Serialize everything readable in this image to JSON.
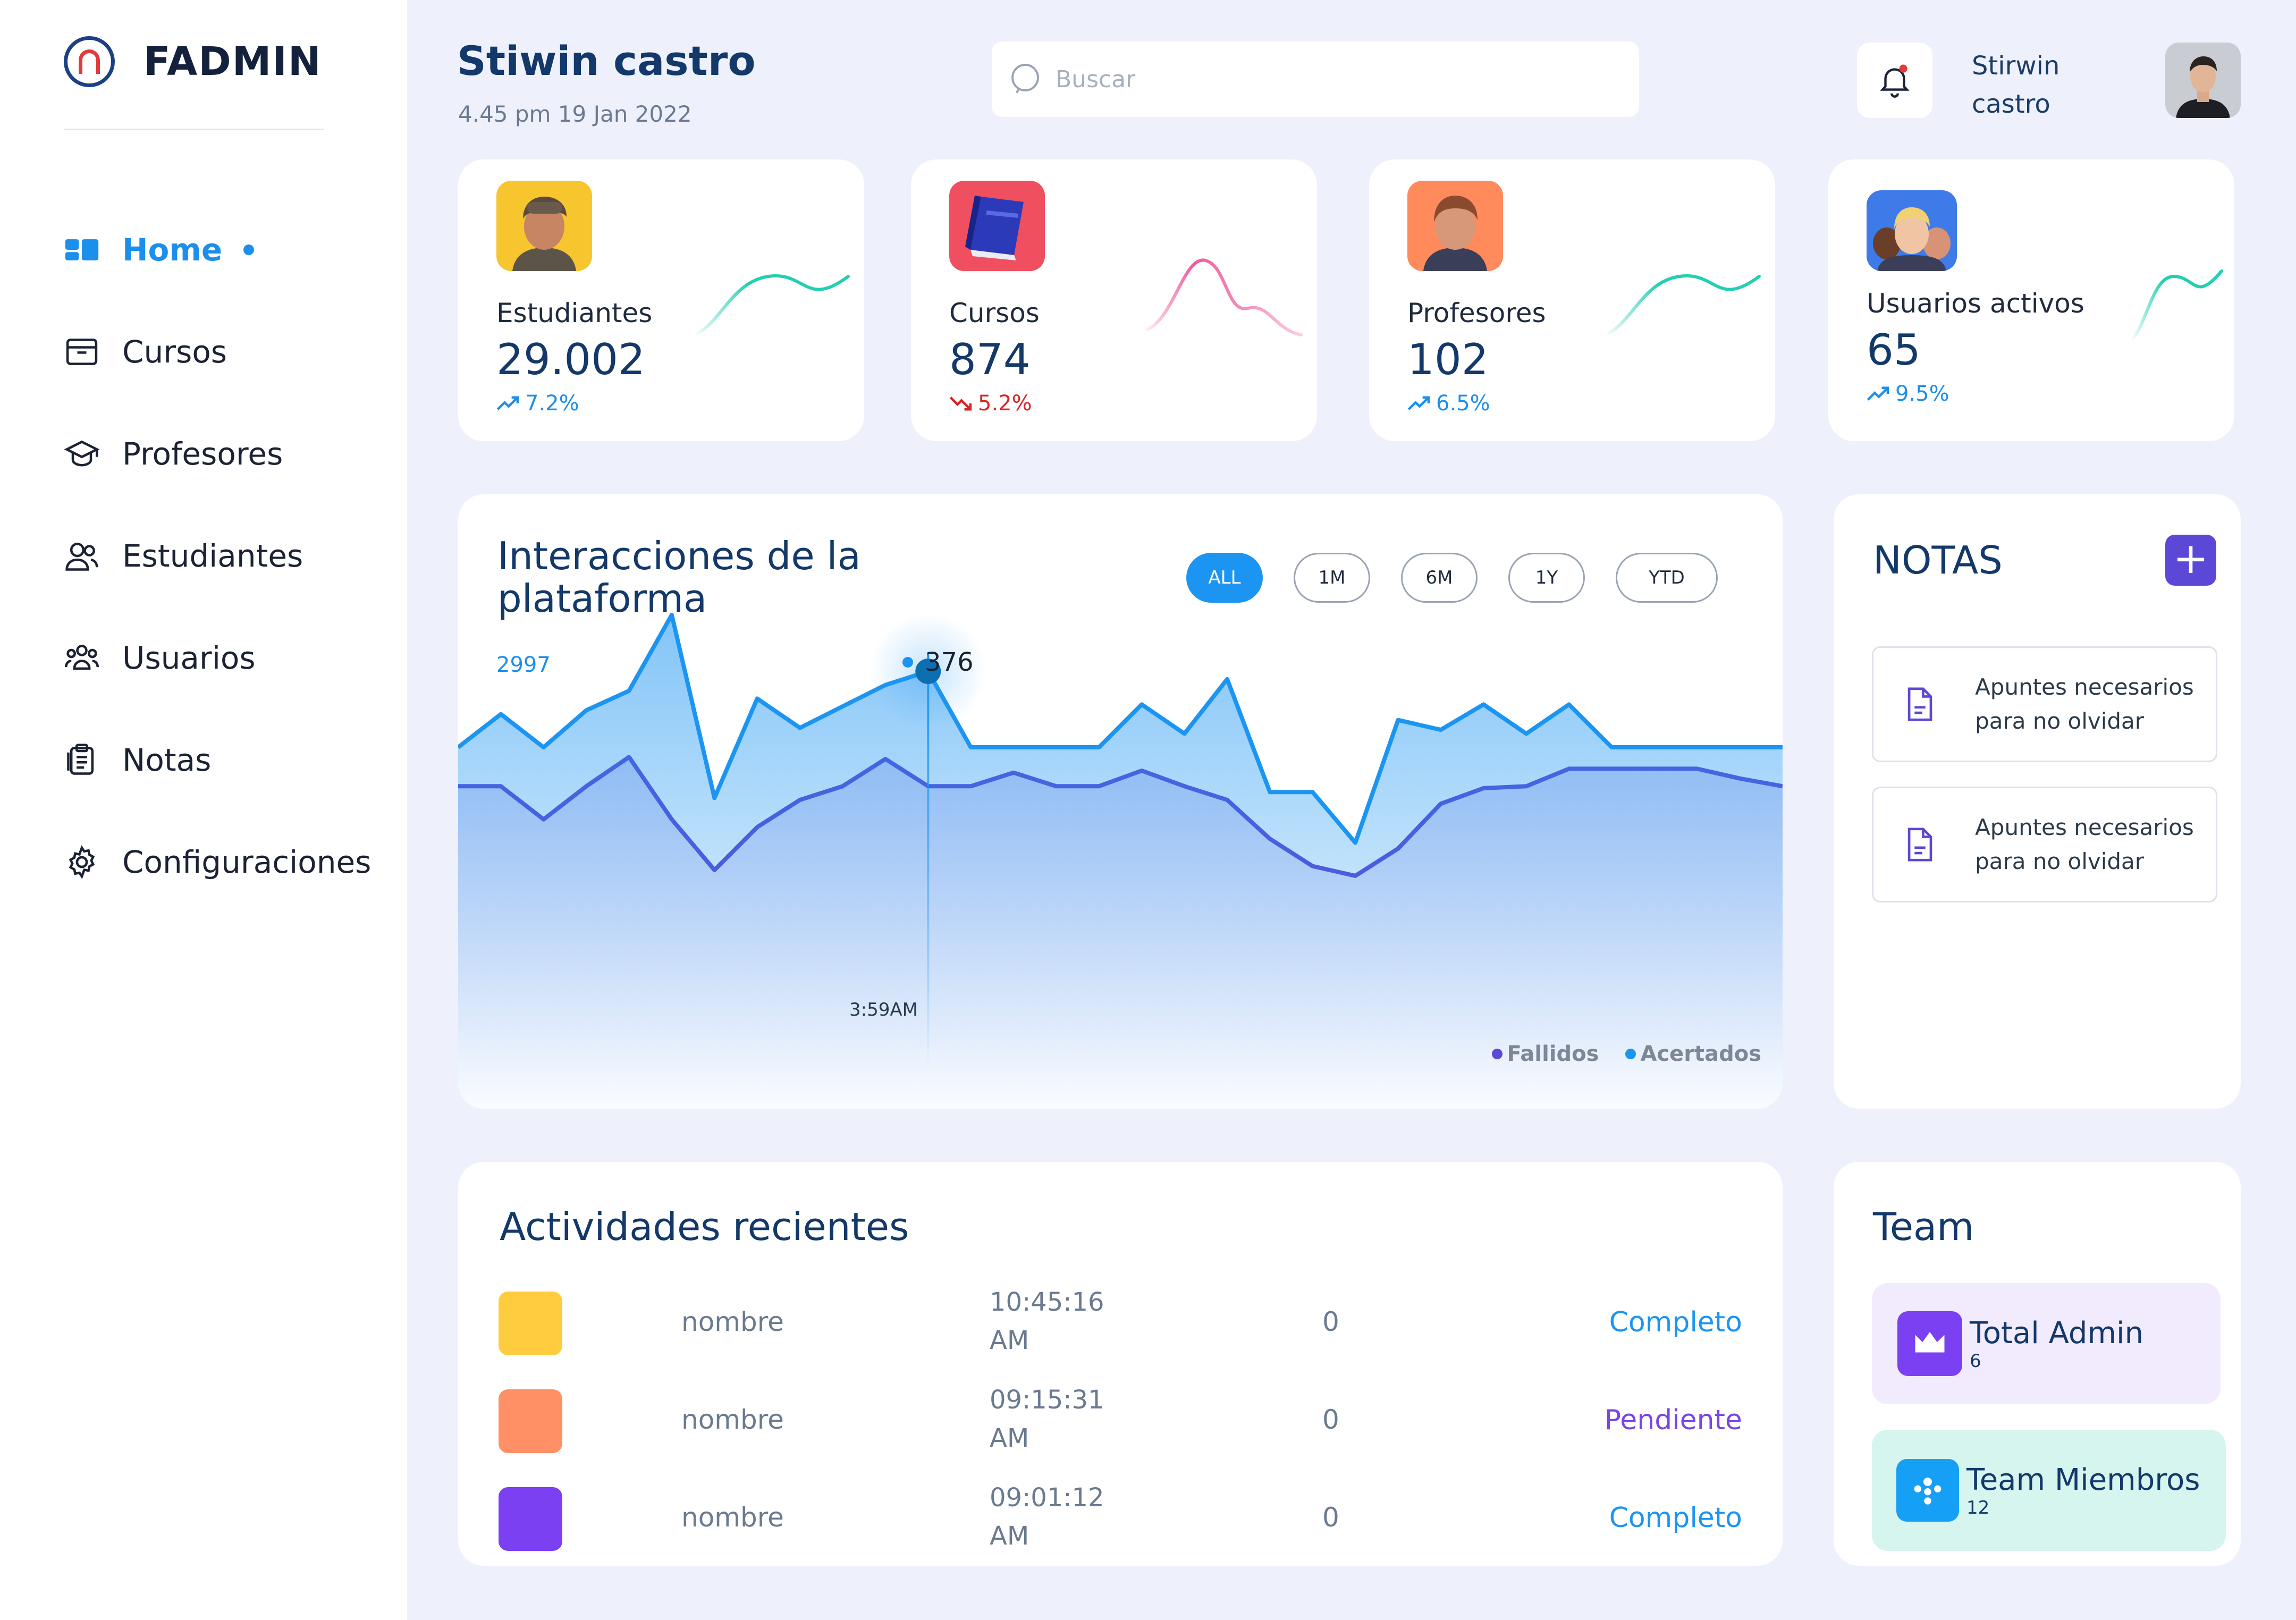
{
  "sidebar": {
    "brand": "FADMIN",
    "items": [
      {
        "label": "Home",
        "icon": "dashboard-icon",
        "active": true
      },
      {
        "label": "Cursos",
        "icon": "courses-icon"
      },
      {
        "label": "Profesores",
        "icon": "graduation-cap-icon"
      },
      {
        "label": "Estudiantes",
        "icon": "users-icon"
      },
      {
        "label": "Usuarios",
        "icon": "group-icon"
      },
      {
        "label": "Notas",
        "icon": "notes-icon"
      },
      {
        "label": "Configuraciones",
        "icon": "gear-icon"
      }
    ]
  },
  "header": {
    "title": "Stiwin castro",
    "datetime": "4.45 pm 19 Jan 2022",
    "search_placeholder": "Buscar",
    "user_name": "Stirwin castro"
  },
  "stats": [
    {
      "label": "Estudiantes",
      "value": "29.002",
      "change": "7.2%",
      "trend": "up",
      "color": "#22cfb0",
      "emoji_bg": "#f7c52e"
    },
    {
      "label": "Cursos",
      "value": "874",
      "change": "5.2%",
      "trend": "down",
      "color": "#ef5a9b",
      "emoji_bg": "#ef4f5f"
    },
    {
      "label": "Profesores",
      "value": "102",
      "change": "6.5%",
      "trend": "up",
      "color": "#22cfb0",
      "emoji_bg": "#ff8a5c"
    },
    {
      "label": "Usuarios activos",
      "value": "65",
      "change": "9.5%",
      "trend": "up",
      "color": "#22cfb0",
      "emoji_bg": "#3e7be8"
    }
  ],
  "chart": {
    "title": "Interacciones de la plataforma",
    "filters": [
      "ALL",
      "1M",
      "6M",
      "1Y",
      "YTD"
    ],
    "active_filter": "ALL",
    "y_max_label": "2997",
    "tooltip_value": "376",
    "tooltip_time": "3:59AM",
    "legend": [
      {
        "name": "Fallidos",
        "color": "#5b48d6"
      },
      {
        "name": "Acertados",
        "color": "#1c95f2"
      }
    ]
  },
  "chart_data": {
    "type": "area",
    "series": [
      {
        "name": "Acertados",
        "values": [
          1610,
          1780,
          1610,
          1800,
          1900,
          2290,
          1350,
          1860,
          1710,
          1820,
          1930,
          2000,
          1610,
          1610,
          1610,
          1610,
          1830,
          1680,
          1960,
          1380,
          1380,
          1120,
          1750,
          1700,
          1830,
          1680,
          1830,
          1610,
          1610,
          1610,
          1610,
          1610
        ]
      },
      {
        "name": "Fallidos",
        "values": [
          1410,
          1410,
          1240,
          1410,
          1560,
          1240,
          980,
          1200,
          1340,
          1410,
          1550,
          1410,
          1410,
          1480,
          1410,
          1410,
          1490,
          1410,
          1340,
          1140,
          1000,
          950,
          1090,
          1320,
          1400,
          1410,
          1500,
          1500,
          1500,
          1500,
          1450,
          1410
        ]
      }
    ],
    "ylim": [
      0,
      2997
    ]
  },
  "notes": {
    "title": "NOTAS",
    "items": [
      {
        "text": "Apuntes necesarios para no olvidar"
      },
      {
        "text": "Apuntes necesarios para no olvidar"
      }
    ]
  },
  "activities": {
    "title": "Actividades recientes",
    "rows": [
      {
        "color": "#ffcc3f",
        "name": "nombre",
        "time": "10:45:16 AM",
        "count": "0",
        "status": "Completo",
        "status_color": "#1c95f2"
      },
      {
        "color": "#ff9065",
        "name": "nombre",
        "time": "09:15:31 AM",
        "count": "0",
        "status": "Pendiente",
        "status_color": "#7a45e8"
      },
      {
        "color": "#7a40f2",
        "name": "nombre",
        "time": "09:01:12 AM",
        "count": "0",
        "status": "Completo",
        "status_color": "#1c95f2"
      }
    ]
  },
  "team": {
    "title": "Team",
    "items": [
      {
        "name": "Total Admin",
        "count": "6",
        "bg": "#f1ebfd",
        "icon_bg": "#7a40f2",
        "icon": "crown-icon"
      },
      {
        "name": "Team Miembros",
        "count": "12",
        "bg": "#d6f5ee",
        "icon_bg": "#16a0f5",
        "icon": "team-icon"
      }
    ]
  }
}
